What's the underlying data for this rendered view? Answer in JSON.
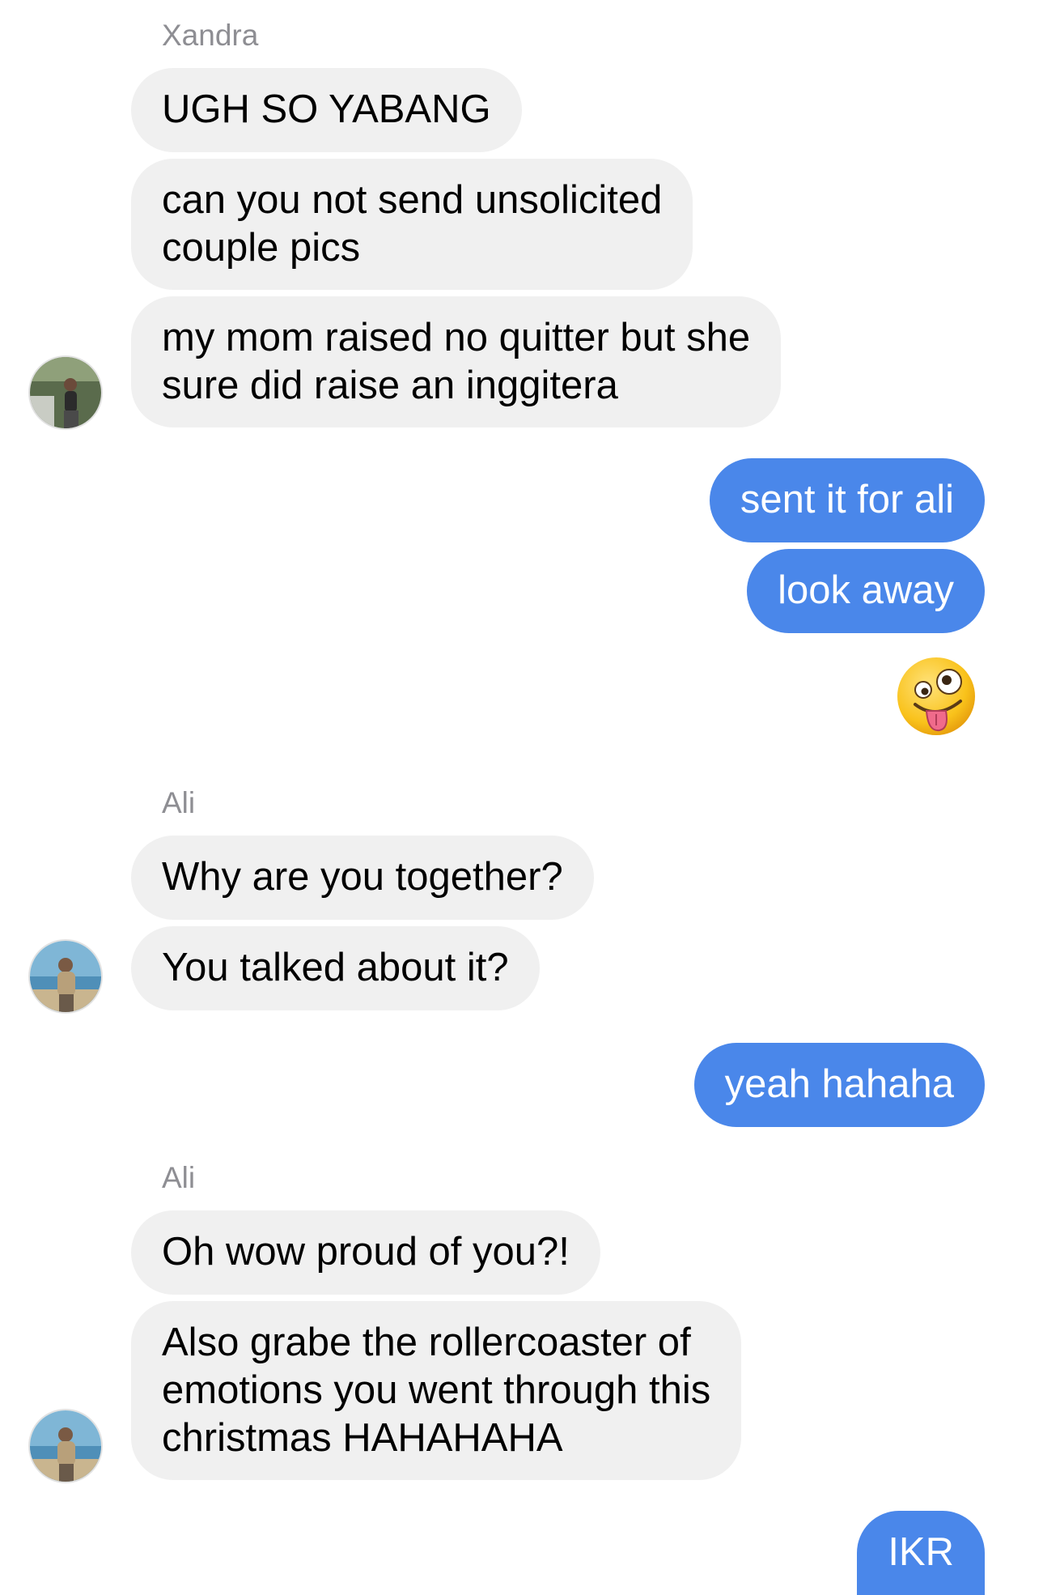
{
  "thread": {
    "xandra_group": {
      "sender": "Xandra",
      "messages": [
        "UGH SO YABANG",
        "can you not send unsolicited\ncouple pics",
        "my mom raised no quitter but she\nsure did raise an inggitera"
      ]
    },
    "outgoing_group_1": {
      "messages": [
        "sent it for ali",
        "look away"
      ],
      "emoji": "zany-face-icon"
    },
    "ali_group_1": {
      "sender": "Ali",
      "messages": [
        "Why are you together?",
        "You talked about it?"
      ]
    },
    "outgoing_group_2": {
      "messages": [
        "yeah hahaha"
      ]
    },
    "ali_group_2": {
      "sender": "Ali",
      "messages": [
        "Oh wow proud of you?!",
        "Also grabe the rollercoaster of\nemotions you went through this\nchristmas HAHAHAHA"
      ]
    },
    "outgoing_group_3": {
      "messages": [
        "IKR"
      ]
    }
  },
  "colors": {
    "incoming_bubble": "#f0f0f0",
    "outgoing_bubble": "#4a87ea",
    "sender_name": "#8e8e93",
    "background": "#ffffff"
  }
}
